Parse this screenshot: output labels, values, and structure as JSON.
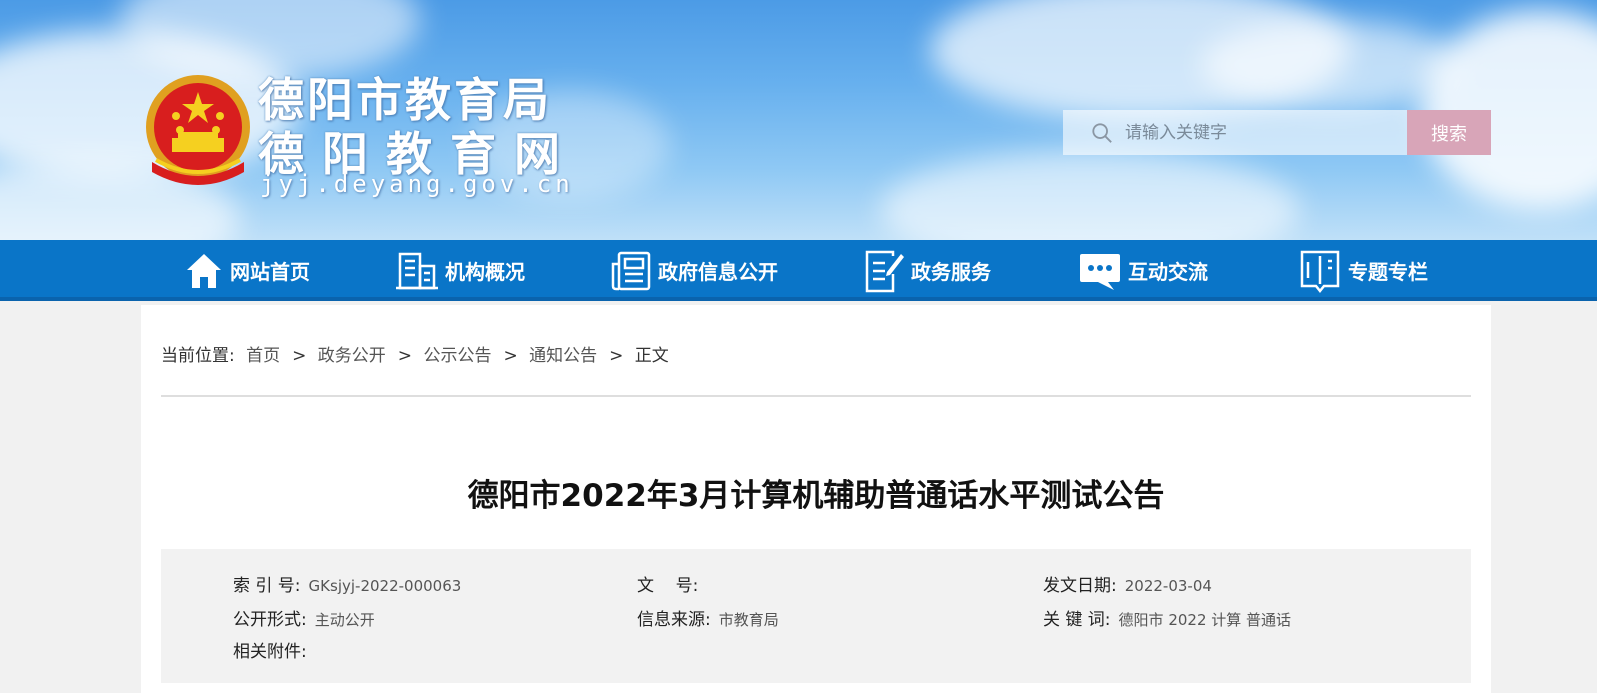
{
  "header": {
    "title_line1": "德阳市教育局",
    "title_line2": "德阳教育网",
    "url": "jyj.deyang.gov.cn",
    "search": {
      "placeholder": "请输入关键字",
      "button_label": "搜索"
    }
  },
  "nav": {
    "items": [
      {
        "label": "网站首页",
        "icon": "home-icon"
      },
      {
        "label": "机构概况",
        "icon": "building-icon"
      },
      {
        "label": "政府信息公开",
        "icon": "newspaper-icon"
      },
      {
        "label": "政务服务",
        "icon": "document-edit-icon"
      },
      {
        "label": "互动交流",
        "icon": "chat-icon"
      },
      {
        "label": "专题专栏",
        "icon": "book-icon"
      }
    ]
  },
  "breadcrumb": {
    "prefix": "当前位置:",
    "items": [
      "首页",
      "政务公开",
      "公示公告",
      "通知公告",
      "正文"
    ],
    "separator": ">"
  },
  "article": {
    "title": "德阳市2022年3月计算机辅助普通话水平测试公告"
  },
  "meta": {
    "index_label": "索 引 号:",
    "index_value": "GKsjyj-2022-000063",
    "doc_no_label": "文    号:",
    "doc_no_value": "",
    "date_label": "发文日期:",
    "date_value": "2022-03-04",
    "disclosure_label": "公开形式:",
    "disclosure_value": "主动公开",
    "source_label": "信息来源:",
    "source_value": "市教育局",
    "keywords_label": "关 键 词:",
    "keywords_value": "德阳市 2022 计算 普通话",
    "attachments_label": "相关附件:"
  },
  "colors": {
    "nav_bg": "#0a75c8",
    "search_button": "#d8a5b8",
    "meta_bg": "#f2f2f2"
  }
}
